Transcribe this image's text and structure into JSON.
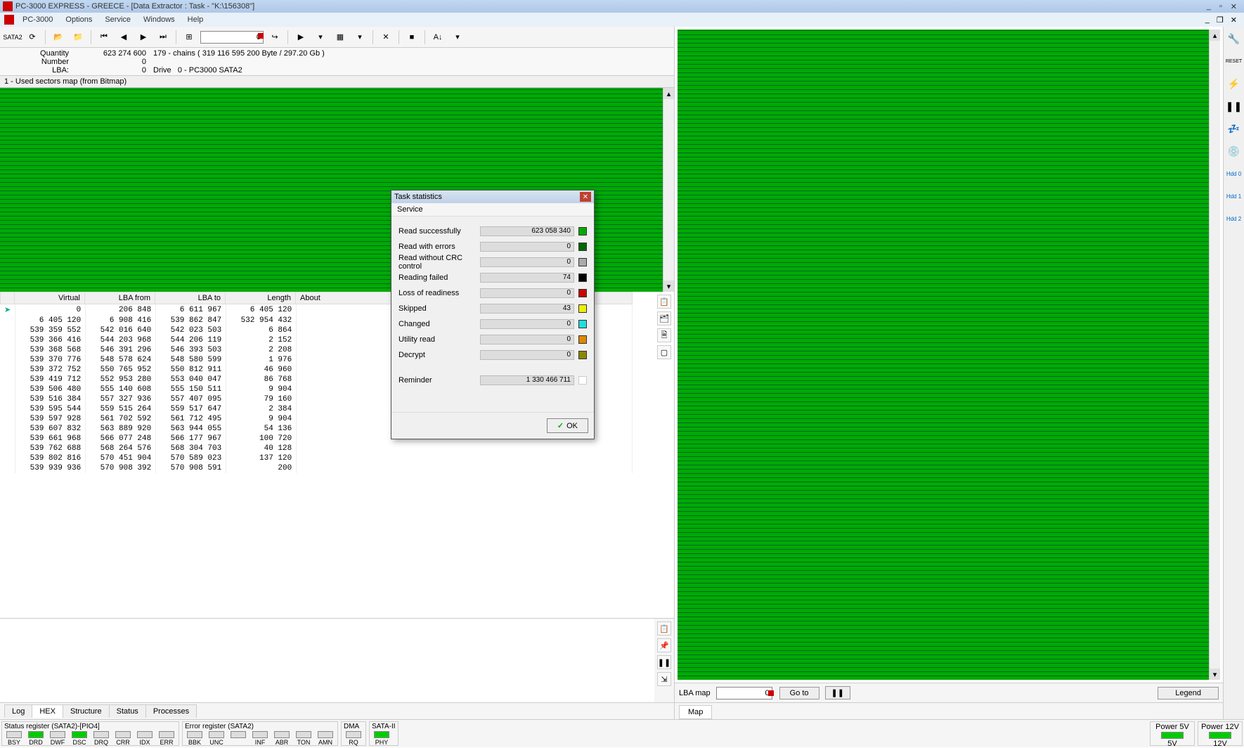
{
  "window": {
    "title": "PC-3000 EXPRESS - GREECE  - [Data Extractor : Task - \"K:\\156308\"]",
    "buttons": {
      "min": "_",
      "max": "▫",
      "close": "✕"
    }
  },
  "menu": {
    "items": [
      "PC-3000",
      "Options",
      "Service",
      "Windows",
      "Help"
    ],
    "mdi": {
      "min": "_",
      "restore": "❐",
      "close": "✕"
    }
  },
  "toolbar": {
    "sata_label": "SATA2",
    "lba_input": "0"
  },
  "info": {
    "labels": {
      "quantity": "Quantity",
      "number": "Number",
      "lba": "LBA:",
      "drive": "Drive"
    },
    "quantity": "623 274 600",
    "chains": "179 - chains  ( 319 116 595 200 Byte /  297.20 Gb )",
    "number": "0",
    "lba": "0",
    "drive": "0 - PC3000 SATA2"
  },
  "map_header": "1 - Used sectors map (from Bitmap)",
  "table": {
    "headers": [
      "Virtual",
      "LBA from",
      "LBA to",
      "Length",
      "About"
    ],
    "rows": [
      [
        "0",
        "206 848",
        "6 611 967",
        "6 405 120",
        ""
      ],
      [
        "6 405 120",
        "6 908 416",
        "539 862 847",
        "532 954 432",
        ""
      ],
      [
        "539 359 552",
        "542 016 640",
        "542 023 503",
        "6 864",
        ""
      ],
      [
        "539 366 416",
        "544 203 968",
        "544 206 119",
        "2 152",
        ""
      ],
      [
        "539 368 568",
        "546 391 296",
        "546 393 503",
        "2 208",
        ""
      ],
      [
        "539 370 776",
        "548 578 624",
        "548 580 599",
        "1 976",
        ""
      ],
      [
        "539 372 752",
        "550 765 952",
        "550 812 911",
        "46 960",
        ""
      ],
      [
        "539 419 712",
        "552 953 280",
        "553 040 047",
        "86 768",
        ""
      ],
      [
        "539 506 480",
        "555 140 608",
        "555 150 511",
        "9 904",
        ""
      ],
      [
        "539 516 384",
        "557 327 936",
        "557 407 095",
        "79 160",
        ""
      ],
      [
        "539 595 544",
        "559 515 264",
        "559 517 647",
        "2 384",
        ""
      ],
      [
        "539 597 928",
        "561 702 592",
        "561 712 495",
        "9 904",
        ""
      ],
      [
        "539 607 832",
        "563 889 920",
        "563 944 055",
        "54 136",
        ""
      ],
      [
        "539 661 968",
        "566 077 248",
        "566 177 967",
        "100 720",
        ""
      ],
      [
        "539 762 688",
        "568 264 576",
        "568 304 703",
        "40 128",
        ""
      ],
      [
        "539 802 816",
        "570 451 904",
        "570 589 023",
        "137 120",
        ""
      ],
      [
        "539 939 936",
        "570 908 392",
        "570 908 591",
        "200",
        ""
      ]
    ]
  },
  "tabs": [
    "Log",
    "HEX",
    "Structure",
    "Status",
    "Processes"
  ],
  "active_tab": 1,
  "dialog": {
    "title": "Task statistics",
    "menu": "Service",
    "stats": [
      {
        "label": "Read successfully",
        "value": "623 058 340",
        "color": "#00aa00"
      },
      {
        "label": "Read with errors",
        "value": "0",
        "color": "#006600"
      },
      {
        "label": "Read without CRC control",
        "value": "0",
        "color": "#aaaaaa"
      },
      {
        "label": "Reading failed",
        "value": "74",
        "color": "#000000"
      },
      {
        "label": "Loss of readiness",
        "value": "0",
        "color": "#cc0000"
      },
      {
        "label": "Skipped",
        "value": "43",
        "color": "#eeee00"
      },
      {
        "label": "Changed",
        "value": "0",
        "color": "#22dddd"
      },
      {
        "label": "Utility read",
        "value": "0",
        "color": "#dd8800"
      },
      {
        "label": "Decrypt",
        "value": "0",
        "color": "#888800"
      }
    ],
    "reminder_label": "Reminder",
    "reminder_value": "1 330 466 711",
    "ok": "OK"
  },
  "right_bar": {
    "lba_map_label": "LBA map",
    "lba_map_value": "0",
    "goto": "Go to",
    "pause": "❚❚",
    "legend": "Legend",
    "tab": "Map"
  },
  "status": {
    "group1_title": "Status register (SATA2)-[PIO4]",
    "group1": [
      {
        "l": "BSY",
        "on": false
      },
      {
        "l": "DRD",
        "on": true
      },
      {
        "l": "DWF",
        "on": false
      },
      {
        "l": "DSC",
        "on": true
      },
      {
        "l": "DRQ",
        "on": false
      },
      {
        "l": "CRR",
        "on": false
      },
      {
        "l": "IDX",
        "on": false
      },
      {
        "l": "ERR",
        "on": false
      }
    ],
    "group2_title": "Error register (SATA2)",
    "group2": [
      {
        "l": "BBK",
        "on": false
      },
      {
        "l": "UNC",
        "on": false
      },
      {
        "l": "",
        "on": false
      },
      {
        "l": "INF",
        "on": false
      },
      {
        "l": "ABR",
        "on": false
      },
      {
        "l": "TON",
        "on": false
      },
      {
        "l": "AMN",
        "on": false
      }
    ],
    "group3_title": "DMA",
    "group3": [
      {
        "l": "RQ",
        "on": false
      }
    ],
    "group4_title": "SATA-II",
    "group4": [
      {
        "l": "PHY",
        "on": true
      }
    ],
    "power5v_title": "Power 5V",
    "power5v": "5V",
    "power12v_title": "Power 12V",
    "power12v": "12V"
  },
  "far_tools_labels": {
    "reset": "RESET",
    "hdd0": "Hdd 0",
    "hdd1": "Hdd 1",
    "hdd2": "Hdd 2"
  }
}
